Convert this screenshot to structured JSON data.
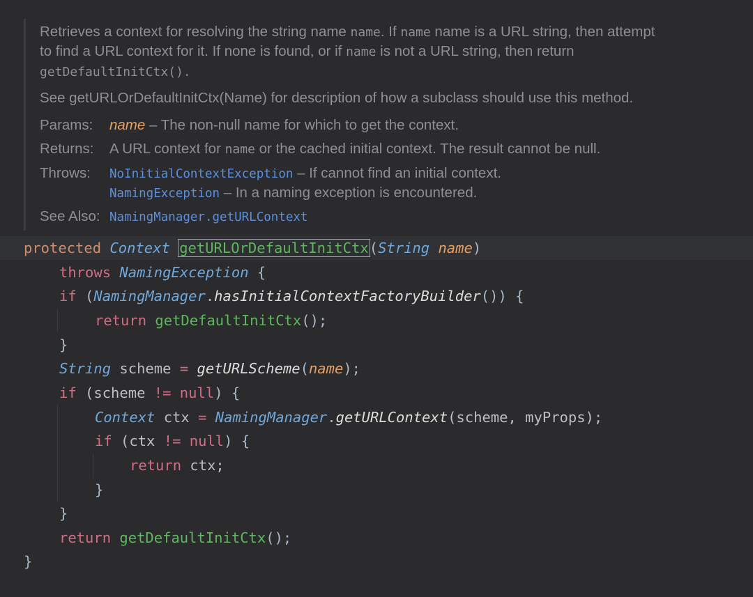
{
  "doc": {
    "line1": "Retrieves a context for resolving the string name ",
    "line1_code": "name",
    "line1b": ". If ",
    "line1_code2": "name",
    "line1c": " name is a URL string, then attempt",
    "line2a": "to find a URL context for it. If none is found, or if ",
    "line2_code": "name",
    "line2b": " is not a URL string, then return",
    "line3_code": "getDefaultInitCtx().",
    "see_desc": "See getURLOrDefaultInitCtx(Name) for description of how a subclass should use this method.",
    "params_label": "Params:",
    "param_name": "name",
    "param_desc": " – The non-null name for which to get the context.",
    "returns_label": "Returns:",
    "returns_a": "A URL context for ",
    "returns_code": "name",
    "returns_b": " or the cached initial context. The result cannot be null.",
    "throws_label": "Throws:",
    "throws1_link": "NoInitialContextException",
    "throws1_desc": " – If cannot find an initial context.",
    "throws2_link": "NamingException",
    "throws2_desc": " – In a naming exception is encountered.",
    "seealso_label": "See Also:",
    "seealso_link": "NamingManager.getURLContext"
  },
  "code": {
    "l1": {
      "kw": "protected",
      "type": "Context",
      "method": "getURLOrDefaultInitCtx",
      "open": "(",
      "ptype": "String",
      "pname": "name",
      "close": ")"
    },
    "l2": {
      "kw": "throws",
      "type": "NamingException",
      "brace": " {"
    },
    "l3": {
      "kw": "if",
      "open": " (",
      "cls": "NamingManager",
      "dot": ".",
      "call": "hasInitialContextFactoryBuilder",
      "close": "()) {"
    },
    "l4": {
      "kw": "return",
      "fn": "getDefaultInitCtx",
      "end": "();"
    },
    "l5": {
      "brace": "}"
    },
    "l6": {
      "type": "String",
      "var": " scheme ",
      "eq": "=",
      "call": " getURLScheme",
      "open": "(",
      "param": "name",
      "end": ");"
    },
    "l7": {
      "kw": "if",
      "open": " (scheme ",
      "op": "!=",
      "null": " null",
      "close": ") {"
    },
    "l8": {
      "type": "Context",
      "var": " ctx ",
      "eq": "=",
      "cls": " NamingManager",
      "dot": ".",
      "call": "getURLContext",
      "args": "(scheme, myProps);"
    },
    "l9": {
      "kw": "if",
      "open": " (ctx ",
      "op": "!=",
      "null": " null",
      "close": ") {"
    },
    "l10": {
      "kw": "return",
      "rest": " ctx;"
    },
    "l11": {
      "brace": "}"
    },
    "l12": {
      "brace": "}"
    },
    "l13": {
      "kw": "return",
      "fn": " getDefaultInitCtx",
      "end": "();"
    },
    "l14": {
      "brace": "}"
    }
  },
  "colors": {
    "background": "#2b2b2d",
    "keyword": "#cf8e6d",
    "link": "#5b8fde",
    "param": "#e8a062",
    "method": "#5fb65f",
    "bulb": "#f2c14e"
  }
}
